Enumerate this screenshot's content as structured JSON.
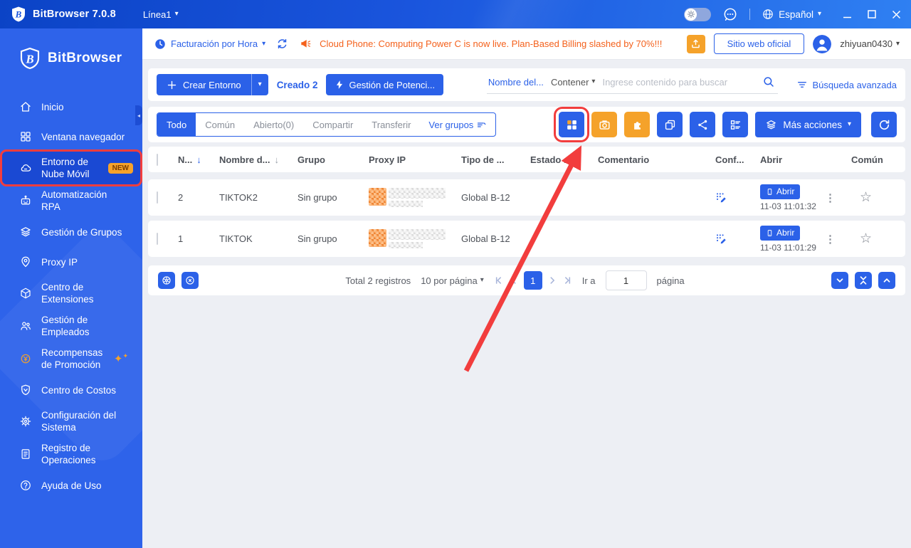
{
  "titlebar": {
    "app_title": "BitBrowser 7.0.8",
    "line_label": "Línea1",
    "language": "Español"
  },
  "header": {
    "billing_label": "Facturación por Hora",
    "announcement": "Cloud Phone: Computing Power C is now live. Plan-Based Billing slashed by 70%!!!",
    "site_button": "Sitio web oficial",
    "username": "zhiyuan0430"
  },
  "sidebar": {
    "brand": "BitBrowser",
    "items": [
      {
        "label": "Inicio",
        "icon": "home-icon"
      },
      {
        "label": "Ventana navegador",
        "icon": "grid-icon"
      },
      {
        "label": "Entorno de Nube Móvil",
        "icon": "cloud-icon",
        "badge": "NEW",
        "active": true
      },
      {
        "label": "Automatización RPA",
        "icon": "robot-icon"
      },
      {
        "label": "Gestión de Grupos",
        "icon": "layers-icon"
      },
      {
        "label": "Proxy IP",
        "icon": "location-pin-icon"
      },
      {
        "label": "Centro de Extensiones",
        "icon": "cube-icon"
      },
      {
        "label": "Gestión de Empleados",
        "icon": "people-icon"
      },
      {
        "label": "Recompensas de Promoción",
        "icon": "reward-icon"
      },
      {
        "label": "Centro de Costos",
        "icon": "shield-icon"
      },
      {
        "label": "Configuración del Sistema",
        "icon": "gear-icon"
      },
      {
        "label": "Registro de Operaciones",
        "icon": "log-icon"
      },
      {
        "label": "Ayuda de Uso",
        "icon": "help-icon"
      }
    ]
  },
  "toolbar": {
    "create_button": "Crear Entorno",
    "created_label": "Creado 2",
    "power_button": "Gestión de Potenci...",
    "search_field": "Nombre del...",
    "search_condition": "Contener",
    "search_placeholder": "Ingrese contenido para buscar",
    "advanced_search": "Búsqueda avanzada"
  },
  "tabs": {
    "all": "Todo",
    "common": "Común",
    "open": "Abierto(0)",
    "share": "Compartir",
    "transfer": "Transferir",
    "view_groups": "Ver grupos"
  },
  "actions": {
    "more_actions": "Más acciones"
  },
  "table": {
    "headers": [
      "N...",
      "Nombre d...",
      "Grupo",
      "Proxy IP",
      "Tipo de ...",
      "Estado ...",
      "Comentario",
      "Conf...",
      "Abrir",
      "Común"
    ],
    "rows": [
      {
        "num": "2",
        "name": "TIKTOK2",
        "group": "Sin grupo",
        "type": "Global B-12",
        "open_label": "Abrir",
        "open_time": "11-03 11:01:32"
      },
      {
        "num": "1",
        "name": "TIKTOK",
        "group": "Sin grupo",
        "type": "Global B-12",
        "open_label": "Abrir",
        "open_time": "11-03 11:01:29"
      }
    ]
  },
  "pagination": {
    "total": "Total 2 registros",
    "per_page": "10 por página",
    "current_page": "1",
    "goto_label": "Ir a",
    "goto_value": "1",
    "page_word": "página"
  },
  "glyphs": {
    "caret_down": "▾",
    "sort_down": "↓",
    "star": "☆",
    "kebab": "⋮",
    "collapse_left": "◂"
  },
  "colors": {
    "accent": "#2b61e8",
    "orange": "#f5a22a",
    "announcement": "#f4611c",
    "annotation": "#f23d3d"
  }
}
